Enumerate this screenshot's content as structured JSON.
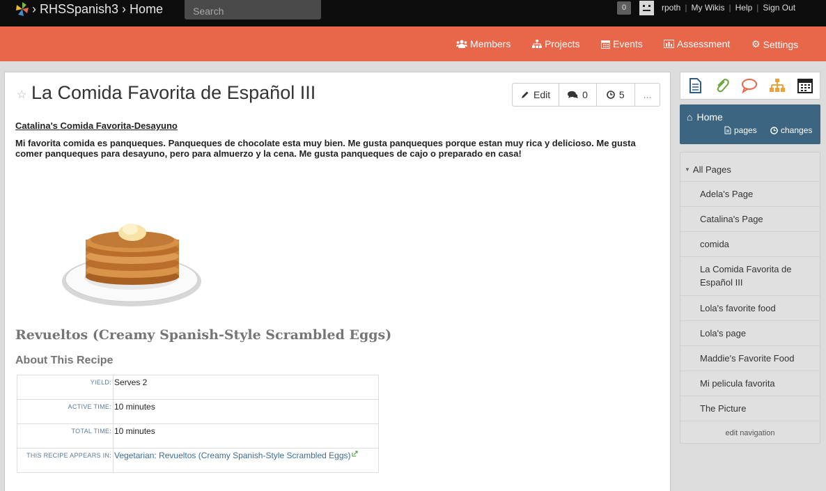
{
  "topbar": {
    "brand": "› RHSSpanish3 › Home",
    "search_placeholder": "Search",
    "notifications": "0",
    "user": "rpoth",
    "links": [
      "My Wikis",
      "Help",
      "Sign Out"
    ]
  },
  "nav": {
    "members": "Members",
    "projects": "Projects",
    "events": "Events",
    "assessment": "Assessment",
    "settings": "Settings"
  },
  "page": {
    "star": "☆",
    "title": "La Comida Favorita de Español III",
    "edit_label": "Edit",
    "comments_count": "0",
    "history_count": "5",
    "more_label": "...",
    "subtitle": "Catalina's Comida Favorita-Desayuno",
    "paragraph": "Mi favorita comida es panqueques. Panqueques de chocolate esta muy bien. Me gusta panqueques porque estan muy rica y delicioso. Me gusta comer panqueques para desayuno, pero para almuerzo y la cena. Me gusta panqueques de cajo o preparado en casa!",
    "recipe_title": "Revueltos (Creamy Spanish-Style Scrambled Eggs)",
    "about_heading": "About This Recipe",
    "recipe_rows": [
      {
        "key": "YIELD:",
        "value": "Serves 2"
      },
      {
        "key": "ACTIVE TIME:",
        "value": "10 minutes"
      },
      {
        "key": "TOTAL TIME:",
        "value": "10 minutes"
      },
      {
        "key": "THIS RECIPE APPEARS IN:",
        "value": "Vegetarian: Revueltos (Creamy Spanish-Style Scrambled Eggs)"
      }
    ]
  },
  "sidebar": {
    "home": "Home",
    "pages": "pages",
    "changes": "changes",
    "all_pages": "All Pages",
    "items": [
      "Adela's Page",
      "Catalina's Page",
      "comida",
      "La Comida Favorita de Español III",
      "Lola's favorite food",
      "Lola's page",
      "Maddie's Favorite Food",
      "Mi pelicula favorita",
      "The Picture"
    ],
    "edit_navigation": "edit navigation"
  },
  "colors": {
    "nav_orange": "#e8674a",
    "home_blue": "#3b6580",
    "topbar": "#0d0d0d"
  }
}
